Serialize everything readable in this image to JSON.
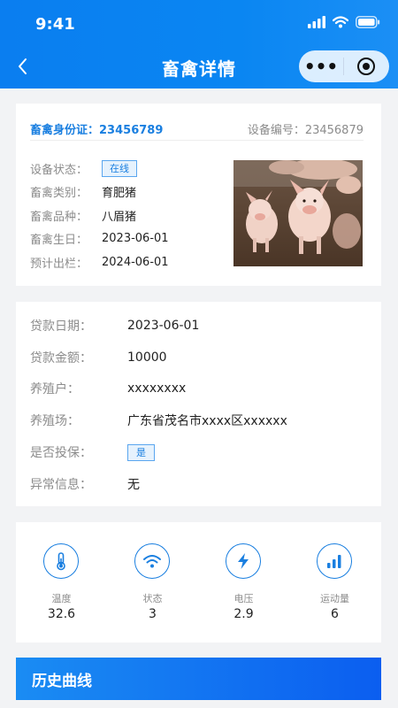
{
  "status_bar": {
    "time": "9:41"
  },
  "header": {
    "title": "畜禽详情",
    "more_glyph": "•••"
  },
  "identity": {
    "id_label": "畜禽身份证：",
    "id_value": "23456789",
    "device_label": "设备编号：",
    "device_value": "23456879"
  },
  "info": [
    {
      "key": "设备状态：",
      "value": "在线",
      "tag": true
    },
    {
      "key": "畜禽类别：",
      "value": "育肥猪"
    },
    {
      "key": "畜禽品种：",
      "value": "八眉猪"
    },
    {
      "key": "畜禽生日：",
      "value": "2023-06-01"
    },
    {
      "key": "预计出栏：",
      "value": "2024-06-01"
    }
  ],
  "loan": [
    {
      "key": "贷款日期：",
      "value": "2023-06-01"
    },
    {
      "key": "贷款金额：",
      "value": "10000"
    },
    {
      "key": "养殖户：",
      "value": "xxxxxxxx"
    },
    {
      "key": "养殖场：",
      "value": "广东省茂名市xxxx区xxxxxx"
    },
    {
      "key": "是否投保：",
      "value": "是",
      "tag": true
    },
    {
      "key": "异常信息：",
      "value": "无"
    }
  ],
  "metrics": [
    {
      "label": "温度",
      "value": "32.6",
      "icon": "thermometer-icon"
    },
    {
      "label": "状态",
      "value": "3",
      "icon": "wifi-signal-icon"
    },
    {
      "label": "电压",
      "value": "2.9",
      "icon": "lightning-icon"
    },
    {
      "label": "运动量",
      "value": "6",
      "icon": "bar-chart-icon"
    }
  ],
  "history": {
    "title": "历史曲线"
  },
  "colors": {
    "primary": "#0a7ef0",
    "accent": "#1a7fe0",
    "page_bg": "#f2f3f5"
  }
}
